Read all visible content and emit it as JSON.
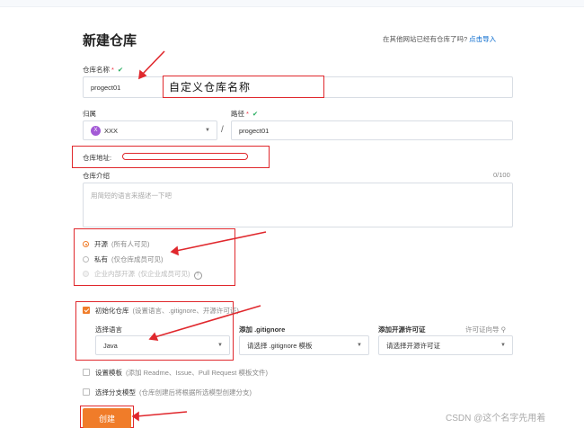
{
  "header": {
    "title": "新建仓库",
    "import_hint": "在其他网站已经有仓库了吗?",
    "import_link": "点击导入"
  },
  "repo_name": {
    "label": "仓库名称",
    "required_mark": "*",
    "valid_icon": "check-icon",
    "value": "progect01",
    "annotation": "自定义仓库名称"
  },
  "owner": {
    "label": "归属",
    "avatar_letter": "X",
    "value": "XXX"
  },
  "path": {
    "label": "路径",
    "required_mark": "*",
    "separator": "/",
    "value": "progect01"
  },
  "repo_address": {
    "label": "仓库地址:"
  },
  "description": {
    "label": "仓库介绍",
    "counter": "0/100",
    "placeholder": "用简短的语言来描述一下吧"
  },
  "visibility": {
    "options": [
      {
        "label": "开源",
        "sub": "(所有人可见)",
        "selected": true,
        "disabled": false
      },
      {
        "label": "私有",
        "sub": "(仅仓库成员可见)",
        "selected": false,
        "disabled": false
      },
      {
        "label": "企业内部开源",
        "sub": "(仅企业成员可见)",
        "selected": false,
        "disabled": true
      }
    ]
  },
  "init_repo": {
    "label": "初始化仓库",
    "sub": "(设置语言、.gitignore、开源许可证)",
    "checked": true
  },
  "language": {
    "label": "选择语言",
    "value": "Java"
  },
  "gitignore": {
    "label": "添加 .gitignore",
    "value": "请选择 .gitignore 模板"
  },
  "license": {
    "label": "添加开源许可证",
    "help": "许可证向导",
    "value": "请选择开源许可证"
  },
  "template": {
    "label": "设置模板",
    "sub": "(添加 Readme、Issue、Pull Request 模板文件)"
  },
  "branch_model": {
    "label": "选择分支模型",
    "sub": "(仓库创建后将根据所选模型创建分支)"
  },
  "submit": {
    "label": "创建"
  },
  "watermark": "CSDN @这个名字先用着",
  "colors": {
    "accent": "#f07c29",
    "annotation_red": "#e0282d",
    "valid_green": "#27ae60",
    "link_blue": "#0066cc"
  }
}
